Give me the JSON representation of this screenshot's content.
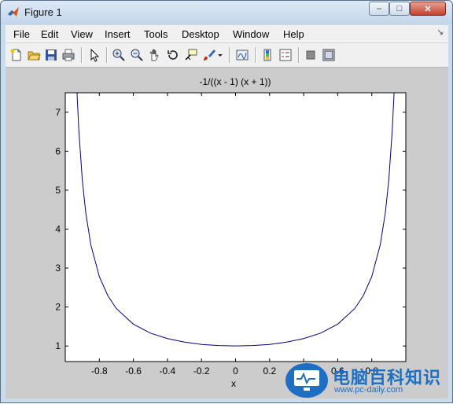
{
  "window": {
    "title": "Figure 1",
    "min_label": "–",
    "max_label": "□",
    "close_label": "✕"
  },
  "menu": [
    "File",
    "Edit",
    "View",
    "Insert",
    "Tools",
    "Desktop",
    "Window",
    "Help"
  ],
  "toolbar_icons": [
    "new-figure-icon",
    "open-icon",
    "save-icon",
    "print-icon",
    "pointer-icon",
    "zoom-in-icon",
    "zoom-out-icon",
    "pan-icon",
    "rotate-icon",
    "data-cursor-icon",
    "brush-icon",
    "link-plot-icon",
    "colorbar-icon",
    "legend-icon",
    "hide-tools-icon",
    "show-tools-icon"
  ],
  "colors": {
    "line": "#00007f",
    "axes_bg": "#ffffff",
    "figure_bg": "#cccccc"
  },
  "chart_data": {
    "type": "line",
    "title": "-1/((x - 1) (x + 1))",
    "xlabel": "x",
    "ylabel": "",
    "xlim": [
      -1,
      1
    ],
    "ylim": [
      0.6,
      7.5
    ],
    "xticks": [
      "-0.8",
      "-0.6",
      "-0.4",
      "-0.2",
      "0",
      "0.2",
      "0.4",
      "0.6",
      "0.8"
    ],
    "yticks": [
      "1",
      "2",
      "3",
      "4",
      "5",
      "6",
      "7"
    ],
    "grid": false,
    "series": [
      {
        "x": [
          -0.9655,
          -0.96,
          -0.95,
          -0.94,
          -0.93,
          -0.92,
          -0.9,
          -0.88,
          -0.85,
          -0.8,
          -0.75,
          -0.7,
          -0.6,
          -0.5,
          -0.4,
          -0.3,
          -0.2,
          -0.1,
          0,
          0.1,
          0.2,
          0.3,
          0.4,
          0.5,
          0.6,
          0.7,
          0.75,
          0.8,
          0.85,
          0.88,
          0.9,
          0.92,
          0.93,
          0.94,
          0.95,
          0.96,
          0.9655
        ],
        "y": [
          14.75,
          12.76,
          10.26,
          8.59,
          7.4,
          6.51,
          5.26,
          4.43,
          3.6,
          2.78,
          2.29,
          1.96,
          1.56,
          1.33,
          1.19,
          1.1,
          1.04,
          1.01,
          1.0,
          1.01,
          1.04,
          1.1,
          1.19,
          1.33,
          1.56,
          1.96,
          2.29,
          2.78,
          3.6,
          4.43,
          5.26,
          6.51,
          7.4,
          8.59,
          10.26,
          12.76,
          14.75
        ]
      }
    ]
  },
  "watermark": {
    "brand": "电脑百科知识",
    "url": "www.pc-daily.com"
  }
}
